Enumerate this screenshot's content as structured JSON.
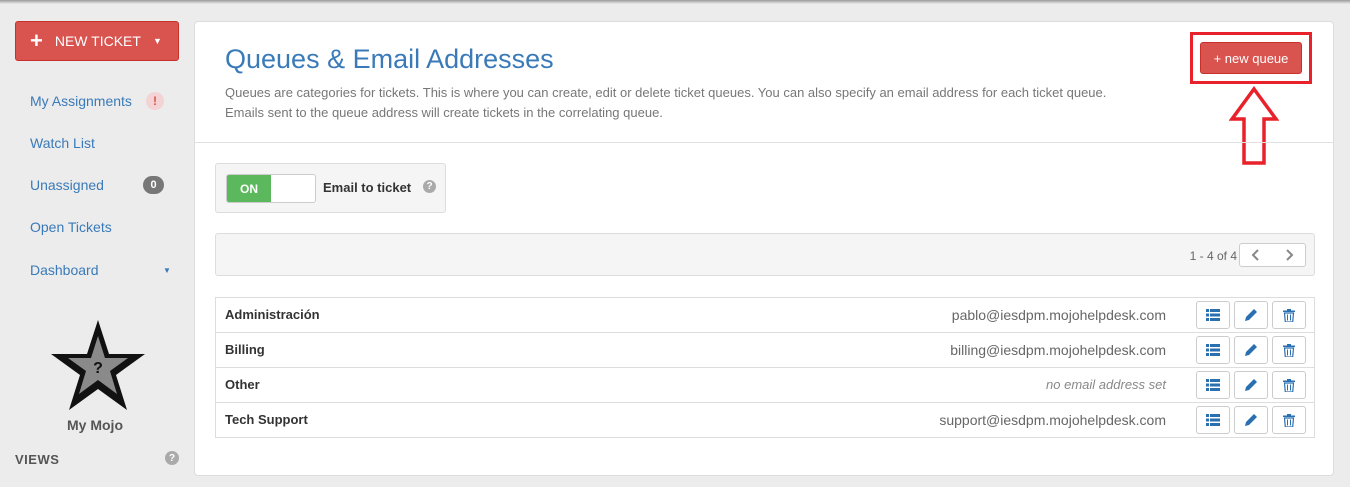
{
  "sidebar": {
    "new_ticket_label": "NEW TICKET",
    "items": [
      {
        "label": "My Assignments",
        "badge": "!"
      },
      {
        "label": "Watch List"
      },
      {
        "label": "Unassigned",
        "badge": "0"
      },
      {
        "label": "Open Tickets"
      },
      {
        "label": "Dashboard"
      }
    ],
    "mojo_label": "My Mojo",
    "mojo_icon_glyph": "?",
    "views_label": "VIEWS",
    "views_help": "?"
  },
  "header": {
    "title": "Queues & Email Addresses",
    "description_line1": "Queues are categories for tickets. This is where you can create, edit or delete ticket queues. You can also specify an email address for each ticket queue.",
    "description_line2": "Emails sent to the queue address will create tickets in the correlating queue.",
    "new_queue_label": "+ new queue"
  },
  "email_to_ticket": {
    "switch_state": "ON",
    "label": "Email to ticket",
    "help": "?"
  },
  "pagination": {
    "range_text": "1 - 4 of 4",
    "prev_icon": "chevron-left-icon",
    "next_icon": "chevron-right-icon"
  },
  "queues": [
    {
      "name": "Administración",
      "email": "pablo@iesdpm.mojohelpdesk.com"
    },
    {
      "name": "Billing",
      "email": "billing@iesdpm.mojohelpdesk.com"
    },
    {
      "name": "Other",
      "email": "no email address set"
    },
    {
      "name": "Tech Support",
      "email": "support@iesdpm.mojohelpdesk.com"
    }
  ],
  "colors": {
    "accent_red": "#d9534f",
    "highlight_red": "#e8212a",
    "link_blue": "#3a7ab8",
    "switch_green": "#5cb85c",
    "icon_blue": "#2a6fb0"
  }
}
